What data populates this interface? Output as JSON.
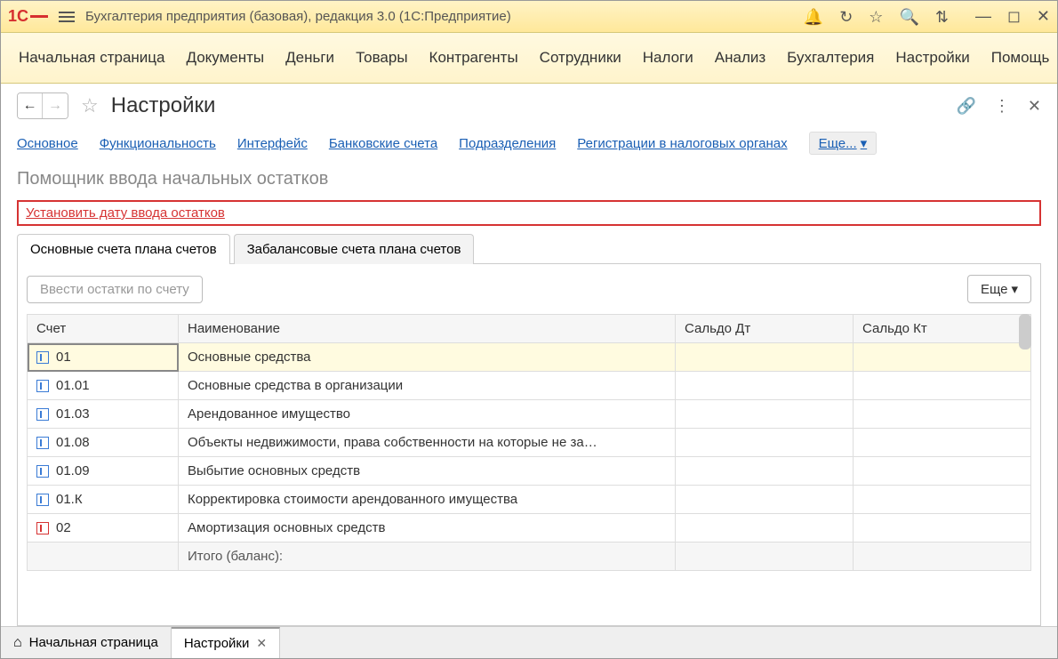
{
  "titlebar": {
    "title": "Бухгалтерия предприятия (базовая), редакция 3.0  (1С:Предприятие)"
  },
  "mainMenu": {
    "items": [
      "Начальная страница",
      "Документы",
      "Деньги",
      "Товары",
      "Контрагенты",
      "Сотрудники",
      "Налоги",
      "Анализ",
      "Бухгалтерия",
      "Настройки",
      "Помощь"
    ]
  },
  "page": {
    "title": "Настройки",
    "subnav": {
      "links": [
        "Основное",
        "Функциональность",
        "Интерфейс",
        "Банковские счета",
        "Подразделения",
        "Регистрации в налоговых органах"
      ],
      "more": "Еще..."
    },
    "subtitle": "Помощник ввода начальных остатков",
    "dateLink": "Установить дату ввода остатков",
    "tabs": {
      "active": "Основные счета плана счетов",
      "inactive": "Забалансовые счета плана счетов"
    },
    "toolbar": {
      "enterBalances": "Ввести остатки по счету",
      "more": "Еще"
    },
    "table": {
      "headers": {
        "acct": "Счет",
        "name": "Наименование",
        "debit": "Сальдо Дт",
        "credit": "Сальдо Кт"
      },
      "rows": [
        {
          "acct": "01",
          "name": "Основные средства",
          "selected": true,
          "red": false
        },
        {
          "acct": "01.01",
          "name": "Основные средства в организации",
          "selected": false,
          "red": false
        },
        {
          "acct": "01.03",
          "name": "Арендованное имущество",
          "selected": false,
          "red": false
        },
        {
          "acct": "01.08",
          "name": "Объекты недвижимости, права собственности на которые не за…",
          "selected": false,
          "red": false
        },
        {
          "acct": "01.09",
          "name": "Выбытие основных средств",
          "selected": false,
          "red": false
        },
        {
          "acct": "01.К",
          "name": "Корректировка стоимости арендованного имущества",
          "selected": false,
          "red": false
        },
        {
          "acct": "02",
          "name": "Амортизация основных средств",
          "selected": false,
          "red": true
        }
      ],
      "totalLabel": "Итого (баланс):"
    }
  },
  "taskbar": {
    "home": "Начальная страница",
    "active": "Настройки"
  }
}
